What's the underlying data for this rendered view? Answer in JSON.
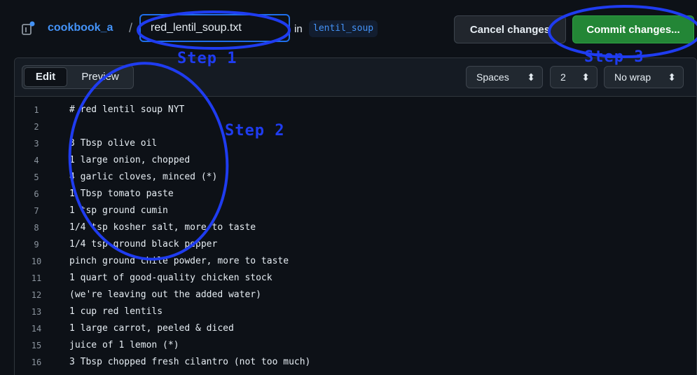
{
  "header": {
    "repo_name": "cookbook_a",
    "separator": "/",
    "filename": "red_lentil_soup.txt",
    "in_label": "in",
    "branch": "lentil_soup",
    "cancel_label": "Cancel changes",
    "commit_label": "Commit changes..."
  },
  "editor": {
    "tabs": [
      {
        "label": "Edit",
        "active": true
      },
      {
        "label": "Preview",
        "active": false
      }
    ],
    "indent_mode": "Spaces",
    "indent_size": "2",
    "wrap_mode": "No wrap",
    "lines": [
      {
        "num": "1",
        "text": "# red lentil soup NYT"
      },
      {
        "num": "2",
        "text": ""
      },
      {
        "num": "3",
        "text": "3 Tbsp olive oil"
      },
      {
        "num": "4",
        "text": "1 large onion, chopped"
      },
      {
        "num": "5",
        "text": "4 garlic cloves, minced (*)"
      },
      {
        "num": "6",
        "text": "1 Tbsp tomato paste"
      },
      {
        "num": "7",
        "text": "1 tsp ground cumin"
      },
      {
        "num": "8",
        "text": "1/4 tsp kosher salt, more to taste"
      },
      {
        "num": "9",
        "text": "1/4 tsp ground black pepper"
      },
      {
        "num": "10",
        "text": "pinch ground chile powder, more to taste"
      },
      {
        "num": "11",
        "text": "1 quart of good-quality chicken stock"
      },
      {
        "num": "12",
        "text": "(we're leaving out the added water)"
      },
      {
        "num": "13",
        "text": "1 cup red lentils"
      },
      {
        "num": "14",
        "text": "1 large carrot, peeled & diced"
      },
      {
        "num": "15",
        "text": "juice of 1 lemon (*)"
      },
      {
        "num": "16",
        "text": "3 Tbsp chopped fresh cilantro (not too much)"
      }
    ]
  },
  "annotations": {
    "step1": "Step 1",
    "step2": "Step 2",
    "step3": "Step 3",
    "color": "#1f3cf0"
  },
  "colors": {
    "background": "#0d1117",
    "accent_link": "#4493f8",
    "commit_green": "#238636",
    "focus_blue": "#1f6feb"
  },
  "icons": {
    "repo": "repo-icon",
    "select_arrows": "up-down-chevron-icon"
  }
}
